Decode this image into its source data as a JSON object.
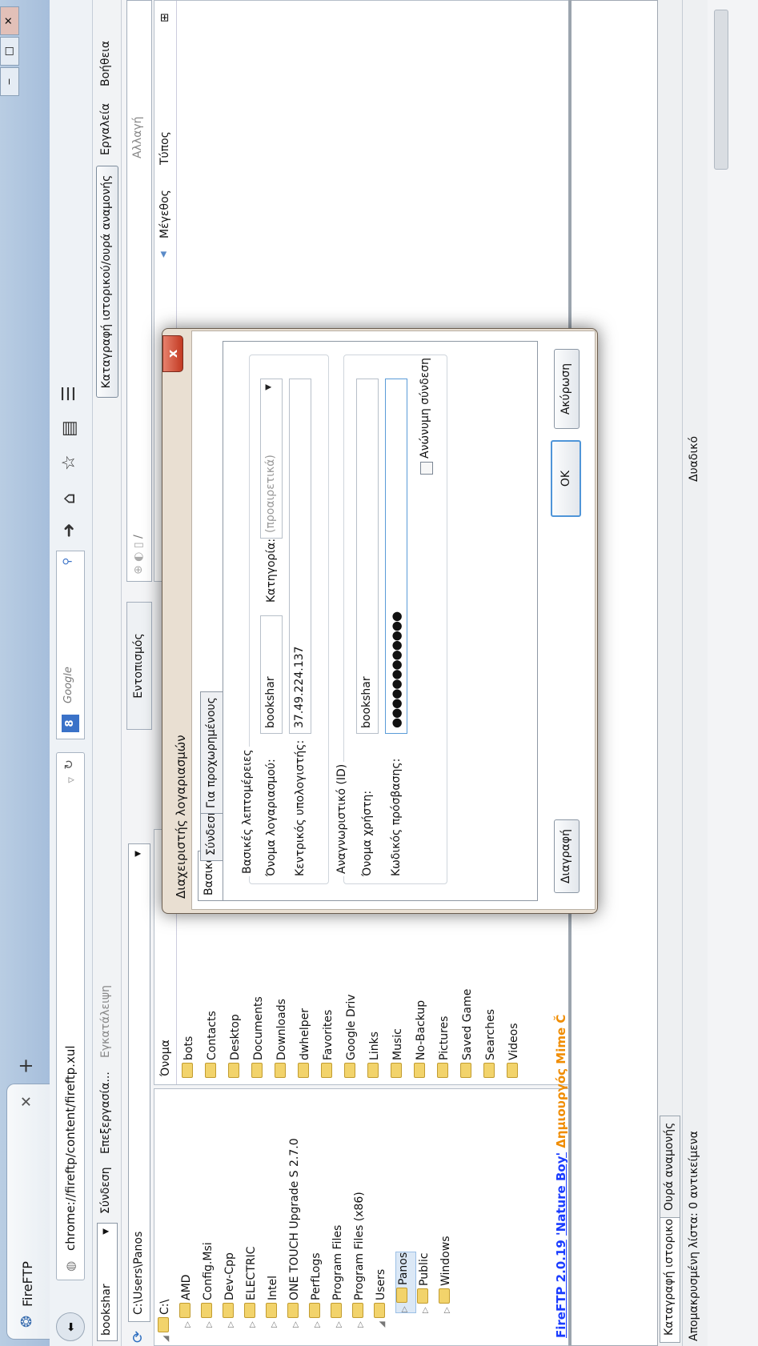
{
  "browser": {
    "tab_title": "FireFTP",
    "new_tab": "+",
    "url": "chrome://fireftp/content/fireftp.xul",
    "search_placeholder": "Google",
    "window_buttons": [
      "‒",
      "□",
      "✕"
    ]
  },
  "toolbar": {
    "account": "bookshar",
    "connect": "Σύνδεση",
    "edit": "Επεξεργασία...",
    "abort": "Εγκατάλειψη",
    "history_toggle": "Καταγραφή ιστορικού/ουρά αναμονής",
    "menu_tools": "Εργαλεία",
    "menu_help": "Βοήθεια",
    "change": "Αλλαγή"
  },
  "local": {
    "path": "C:\\Users\\Panos",
    "locate": "Εντοπισμός",
    "tree": [
      {
        "label": "C:\\",
        "depth": 0,
        "open": true
      },
      {
        "label": "AMD",
        "depth": 1
      },
      {
        "label": "Config.Msi",
        "depth": 1
      },
      {
        "label": "Dev-Cpp",
        "depth": 1
      },
      {
        "label": "ELECTRIC",
        "depth": 1
      },
      {
        "label": "Intel",
        "depth": 1
      },
      {
        "label": "ONE TOUCH Upgrade S 2.7.0",
        "depth": 1
      },
      {
        "label": "PerfLogs",
        "depth": 1
      },
      {
        "label": "Program Files",
        "depth": 1
      },
      {
        "label": "Program Files (x86)",
        "depth": 1
      },
      {
        "label": "Users",
        "depth": 1,
        "open": true
      },
      {
        "label": "Panos",
        "depth": 2,
        "selected": true
      },
      {
        "label": "Public",
        "depth": 2
      },
      {
        "label": "Windows",
        "depth": 2
      }
    ],
    "files_header": "Όνομα",
    "files": [
      "bots",
      "Contacts",
      "Desktop",
      "Documents",
      "Downloads",
      "dwhelper",
      "Favorites",
      "Google Driv",
      "Links",
      "Music",
      "No-Backup",
      "Pictures",
      "Saved Game",
      "Searches",
      "Videos"
    ]
  },
  "remote": {
    "path": "/",
    "col_size": "Μέγεθος",
    "col_type": "Τύπος"
  },
  "footer": {
    "version": "FireFTP 2.0.19",
    "nickname": "'Nature Boy'",
    "by": "Δημιουργός Mime Č",
    "tab_history": "Καταγραφή ιστορικού",
    "tab_queue": "Ουρά αναμονής",
    "status_left": "Απομακρυσμένη λίστα: 0 αντικείμενα",
    "status_mode": "Δυαδικό"
  },
  "dialog": {
    "title": "Διαχειριστής λογαριασμών",
    "close": "x",
    "tabs": [
      "Βασικό",
      "Σύνδεση",
      "Για προχωρημένους"
    ],
    "basic_group": "Βασικές λεπτομέρειες",
    "account_label": "Όνομα λογαριασμού:",
    "account_value": "bookshar",
    "category_label": "Κατηγορία:",
    "category_placeholder": "(προαιρετικά)",
    "host_label": "Κεντρικός υπολογιστής:",
    "host_value": "37.49.224.137",
    "id_group": "Αναγνωριστικό (ID)",
    "user_label": "Όνομα χρήστη:",
    "user_value": "bookshar",
    "pass_label": "Κωδικός πρόσβασης:",
    "pass_value": "●●●●●●●●●●●●",
    "anon_label": "Ανώνυμη σύνδεση",
    "delete": "Διαγραφή",
    "ok": "OK",
    "cancel": "Ακύρωση"
  }
}
